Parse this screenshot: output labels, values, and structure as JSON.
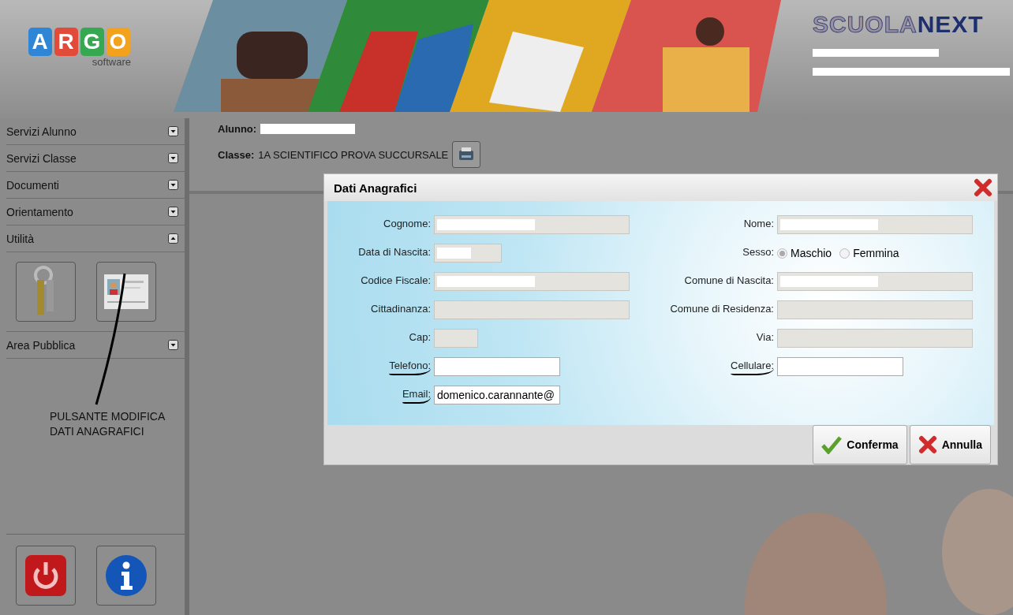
{
  "header": {
    "logo_letters": [
      "A",
      "R",
      "G",
      "O"
    ],
    "logo_sub": "software",
    "brand": [
      "SCUOLA",
      "NEXT"
    ]
  },
  "sidebar": {
    "sections": [
      {
        "label": "Servizi Alunno",
        "expanded": false
      },
      {
        "label": "Servizi Classe",
        "expanded": false
      },
      {
        "label": "Documenti",
        "expanded": false
      },
      {
        "label": "Orientamento",
        "expanded": false
      },
      {
        "label": "Utilità",
        "expanded": true,
        "tools": [
          {
            "kind": "keys"
          },
          {
            "kind": "profile-card"
          }
        ]
      },
      {
        "label": "Area Pubblica",
        "expanded": false
      }
    ],
    "annotation": "PULSANTE MODIFICA DATI ANAGRAFICI",
    "footer_buttons": [
      {
        "kind": "power"
      },
      {
        "kind": "info"
      }
    ]
  },
  "student": {
    "label": "Alunno:",
    "redacted": true
  },
  "class_info": {
    "label": "Classe:",
    "value": "1A SCIENTIFICO PROVA SUCCURSALE"
  },
  "dialog": {
    "title": "Dati Anagrafici",
    "left": [
      {
        "label": "Cognome:",
        "kind": "long",
        "readonly": true,
        "redacted": true,
        "underlined": false
      },
      {
        "label": "Data di Nascita:",
        "kind": "date",
        "readonly": true,
        "redacted": true,
        "underlined": false
      },
      {
        "label": "Codice Fiscale:",
        "kind": "long",
        "readonly": true,
        "redacted": true,
        "underlined": false
      },
      {
        "label": "Cittadinanza:",
        "kind": "long",
        "readonly": true,
        "underlined": false
      },
      {
        "label": "Cap:",
        "kind": "short",
        "readonly": true,
        "underlined": false
      },
      {
        "label": "Telefono:",
        "kind": "medium",
        "readonly": false,
        "underlined": true
      },
      {
        "label": "Email:",
        "kind": "medium",
        "readonly": false,
        "underlined": true,
        "value": "domenico.carannante@"
      }
    ],
    "right": [
      {
        "label": "Nome:",
        "kind": "long",
        "readonly": true,
        "redacted": true,
        "underlined": false
      },
      {
        "label": "Sesso:",
        "kind": "radio",
        "underlined": false,
        "options": [
          {
            "label": "Maschio",
            "selected": true
          },
          {
            "label": "Femmina",
            "selected": false
          }
        ]
      },
      {
        "label": "Comune di Nascita:",
        "kind": "long",
        "readonly": true,
        "redacted": true,
        "underlined": false
      },
      {
        "label": "Comune di Residenza:",
        "kind": "long",
        "readonly": true,
        "underlined": false
      },
      {
        "label": "Via:",
        "kind": "long",
        "readonly": true,
        "underlined": false
      },
      {
        "label": "Cellulare:",
        "kind": "medium",
        "readonly": false,
        "underlined": true
      }
    ],
    "buttons": [
      {
        "label": "Conferma",
        "kind": "confirm"
      },
      {
        "label": "Annulla",
        "kind": "cancel"
      }
    ]
  }
}
